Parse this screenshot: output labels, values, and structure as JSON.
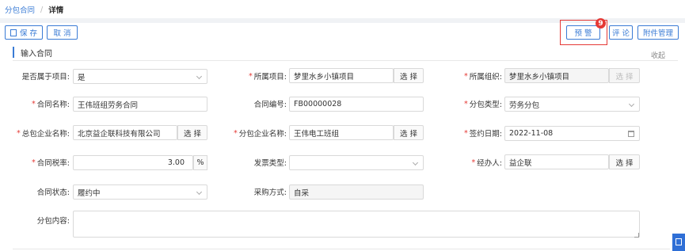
{
  "breadcrumb": {
    "parent": "分包合同",
    "separator": "/",
    "current": "详情"
  },
  "toolbar": {
    "save": "保 存",
    "cancel": "取 消",
    "warning": "预 警",
    "comment": "评 论",
    "attachments": "附件管理",
    "warning_badge": "9"
  },
  "section": {
    "title": "输入合同",
    "collapse": "收起"
  },
  "form": {
    "belongs_project": {
      "label": "是否属于项目:",
      "value": "是"
    },
    "project": {
      "label": "所属项目:",
      "value": "梦里水乡小镇项目",
      "button": "选 择"
    },
    "org": {
      "label": "所属组织:",
      "value": "梦里水乡小镇项目",
      "button": "选 择"
    },
    "contract_name": {
      "label": "合同名称:",
      "value": "王伟班组劳务合同"
    },
    "contract_no": {
      "label": "合同编号:",
      "value": "FB00000028"
    },
    "sub_type": {
      "label": "分包类型:",
      "value": "劳务分包"
    },
    "main_company": {
      "label": "总包企业名称:",
      "value": "北京益企联科技有限公司",
      "button": "选 择"
    },
    "sub_company": {
      "label": "分包企业名称:",
      "value": "王伟电工班组",
      "button": "选 择"
    },
    "sign_date": {
      "label": "签约日期:",
      "value": "2022-11-08"
    },
    "tax_rate": {
      "label": "合同税率:",
      "value": "3.00",
      "unit": "%"
    },
    "invoice_type": {
      "label": "发票类型:",
      "value": ""
    },
    "handler": {
      "label": "经办人:",
      "value": "益企联",
      "button": "选 择"
    },
    "status": {
      "label": "合同状态:",
      "value": "履约中"
    },
    "purchase": {
      "label": "采购方式:",
      "value": "自采"
    },
    "content": {
      "label": "分包内容:",
      "value": ""
    }
  },
  "colors": {
    "accent": "#3a7bd5",
    "required": "#e53935",
    "badge": "#e53935"
  }
}
